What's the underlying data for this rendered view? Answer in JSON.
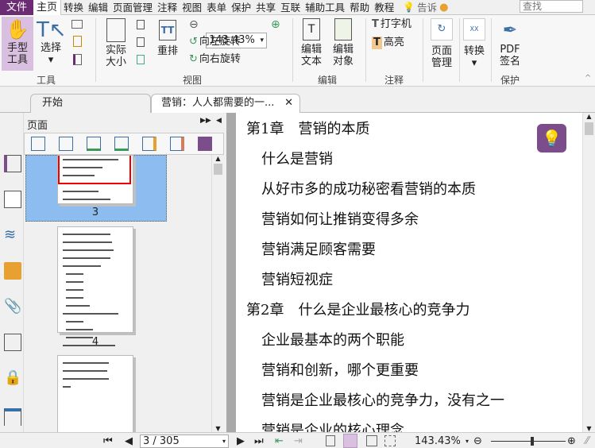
{
  "menubar": {
    "file": "文件",
    "home": "主页",
    "items": [
      "转换",
      "编辑",
      "页面管理",
      "注释",
      "视图",
      "表单",
      "保护",
      "共享",
      "互联",
      "辅助工具",
      "帮助",
      "教程"
    ],
    "tell": "告诉",
    "search_placeholder": "查找"
  },
  "ribbon": {
    "hand": "手型\n工具",
    "select": "选择",
    "tools_group": "工具",
    "actual_size": "实际\n大小",
    "reflow": "重排",
    "zoom_value": "143.43%",
    "rotate_left": "向左旋转",
    "rotate_right": "向右旋转",
    "view_group": "视图",
    "edit_text": "编辑\n文本",
    "edit_object": "编辑\n对象",
    "edit_group": "编辑",
    "typewriter": "打字机",
    "highlight": "高亮",
    "comment_group": "注释",
    "page_manage": "页面\n管理",
    "convert": "转换",
    "pdf_sign": "PDF\n签名",
    "protect_group": "保护"
  },
  "tabs": [
    {
      "label": "开始"
    },
    {
      "label": "营销：人人都需要的一..."
    }
  ],
  "panel": {
    "title": "页面",
    "pages": [
      "3",
      "4"
    ]
  },
  "document": {
    "lines": [
      {
        "text": "第1章　营销的本质",
        "level": 0
      },
      {
        "text": "什么是营销",
        "level": 1
      },
      {
        "text": "从好市多的成功秘密看营销的本质",
        "level": 1
      },
      {
        "text": "营销如何让推销变得多余",
        "level": 1
      },
      {
        "text": "营销满足顾客需要",
        "level": 1
      },
      {
        "text": "营销短视症",
        "level": 1
      },
      {
        "text": "第2章　什么是企业最核心的竞争力",
        "level": 0
      },
      {
        "text": "企业最基本的两个职能",
        "level": 1
      },
      {
        "text": "营销和创新，哪个更重要",
        "level": 1
      },
      {
        "text": "营销是企业最核心的竞争力，没有之一",
        "level": 1
      },
      {
        "text": "营销是企业的核心理念",
        "level": 1
      }
    ]
  },
  "status": {
    "page": "3 / 305",
    "zoom": "143.43%",
    "zoom_slider": 0.55
  },
  "colors": {
    "accent": "#6b2c74",
    "hand_bg": "#d9bfe0",
    "thumb_sel": "#8dbdf0"
  }
}
